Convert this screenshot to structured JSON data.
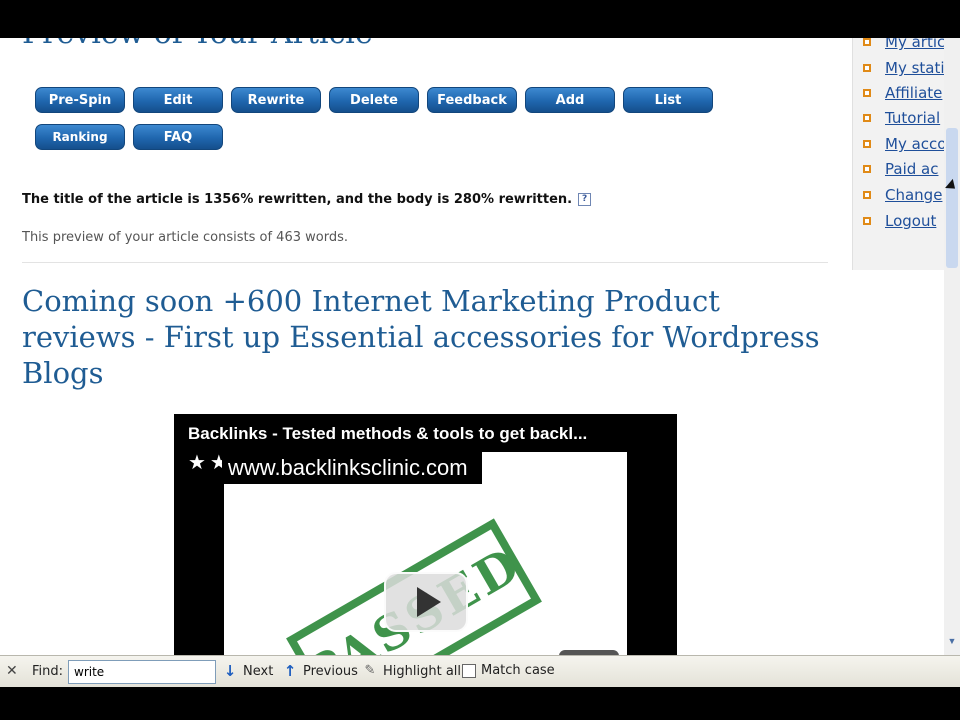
{
  "page": {
    "heading_partial": "Preview of Your Article",
    "buttons_row1": [
      "Pre-Spin",
      "Edit",
      "Rewrite",
      "Delete",
      "Feedback",
      "Add",
      "List"
    ],
    "buttons_row2": [
      "Ranking",
      "FAQ"
    ],
    "rewritten_text": "The title of the article is 1356% rewritten, and the body is 280% rewritten.",
    "help_icon_glyph": "?",
    "word_count_text": "This preview of your article consists of 463 words.",
    "article_title": "Coming soon +600 Internet Marketing Product reviews - First up Essential accessories for Wordpress Blogs"
  },
  "video": {
    "title": "Backlinks - Tested methods & tools to get backl...",
    "stars": "★★★★★",
    "url": "www.backlinksclinic.com",
    "stamp_text": "PASSED"
  },
  "sidebar": {
    "items": [
      "My articl",
      "My stati",
      "Affiliate",
      "Tutorial",
      "My acco",
      "Paid ac",
      "Change",
      "Logout"
    ]
  },
  "findbar": {
    "close_glyph": "✕",
    "label": "Find:",
    "query": "write",
    "next_label": "Next",
    "previous_label": "Previous",
    "highlight_label": "Highlight all",
    "match_case_label": "Match case"
  },
  "colors": {
    "link": "#1f4f9a",
    "heading": "#1f5c93",
    "button": "#1f66ae",
    "bullet": "#e08a17"
  }
}
